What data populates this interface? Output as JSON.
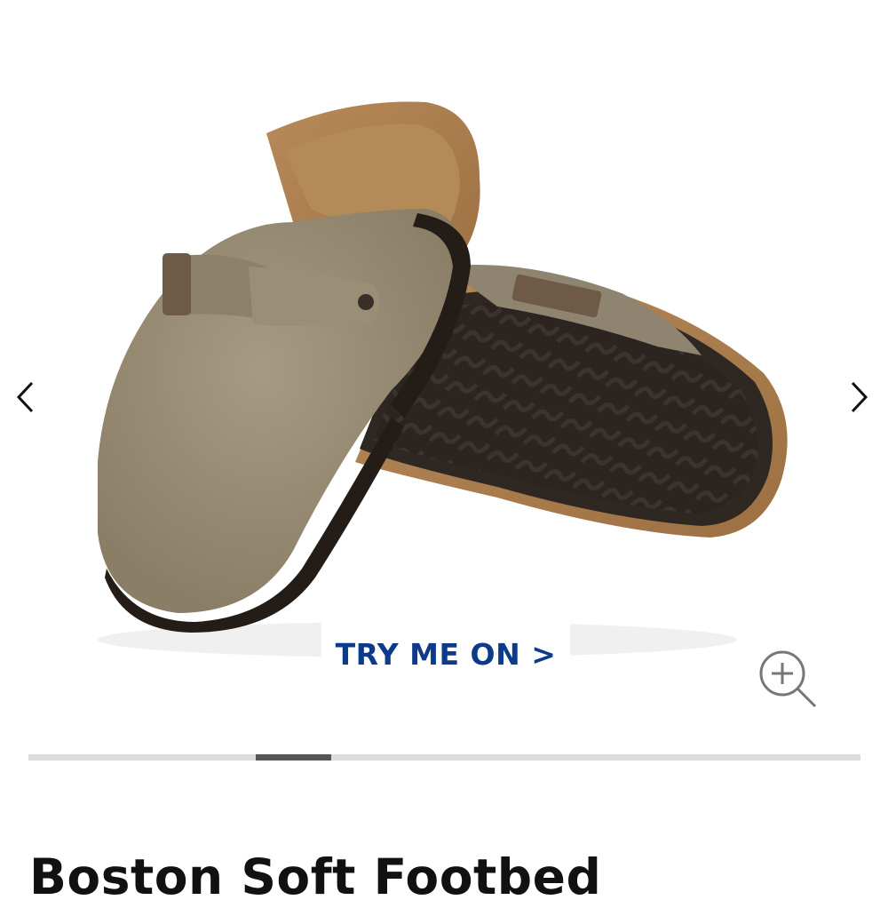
{
  "gallery": {
    "slide_index": 3,
    "slide_count": 11,
    "prev_icon": "chevron-left-icon",
    "next_icon": "chevron-right-icon",
    "zoom_icon": "zoom-in-icon",
    "try_on_label": "TRY ME ON >"
  },
  "product": {
    "title": "Boston Soft Footbed"
  },
  "colors": {
    "accent": "#0d3b8c",
    "progress_thumb": "#555555",
    "progress_track": "#dcdcdc"
  }
}
